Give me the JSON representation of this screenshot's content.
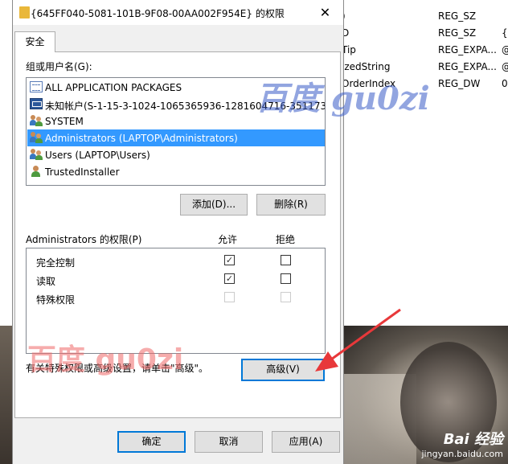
{
  "dialog": {
    "title": "{645FF040-5081-101B-9F08-00AA002F954E} 的权限",
    "close_glyph": "✕",
    "tab_security": "安全",
    "group_label": "组或用户名(G):",
    "users": [
      {
        "label": "ALL APPLICATION PACKAGES",
        "icon": "package-icon",
        "selected": false
      },
      {
        "label": "未知帐户(S-1-15-3-1024-1065365936-1281604716-351173...",
        "icon": "unknown-account-icon",
        "selected": false
      },
      {
        "label": "SYSTEM",
        "icon": "group-icon",
        "selected": false
      },
      {
        "label": "Administrators (LAPTOP\\Administrators)",
        "icon": "group-icon",
        "selected": true
      },
      {
        "label": "Users (LAPTOP\\Users)",
        "icon": "group-icon",
        "selected": false
      },
      {
        "label": "TrustedInstaller",
        "icon": "user-icon",
        "selected": false
      }
    ],
    "add_button": "添加(D)...",
    "remove_button": "删除(R)",
    "perm_label": "Administrators 的权限(P)",
    "allow_header": "允许",
    "deny_header": "拒绝",
    "permissions": [
      {
        "label": "完全控制",
        "allow": true,
        "deny": false,
        "disabled": false
      },
      {
        "label": "读取",
        "allow": true,
        "deny": false,
        "disabled": false
      },
      {
        "label": "特殊权限",
        "allow": false,
        "deny": false,
        "disabled": true
      }
    ],
    "special_hint": "有关特殊权限或高级设置，请单击\"高级\"。",
    "advanced_button": "高级(V)",
    "ok_button": "确定",
    "cancel_button": "取消",
    "apply_button": "应用(A)"
  },
  "registry_bg": {
    "rows": [
      {
        "name": ")",
        "type": "REG_SZ",
        "data": ""
      },
      {
        "name": "D",
        "type": "REG_SZ",
        "data": "{E"
      },
      {
        "name": "Tip",
        "type": "REG_EXPA...",
        "data": "@"
      },
      {
        "name": "izedString",
        "type": "REG_EXPA...",
        "data": "@"
      },
      {
        "name": "OrderIndex",
        "type": "REG_DW",
        "data": "0"
      }
    ]
  },
  "watermarks": {
    "top": "百度 gu0zi",
    "bottom": "百度 gu0zi",
    "baidu_logo": "Bai 经验",
    "baidu_url": "jingyan.baidu.com"
  },
  "colors": {
    "selection": "#3399ff",
    "arrow": "#e8383a",
    "primary_border": "#0078d7"
  }
}
